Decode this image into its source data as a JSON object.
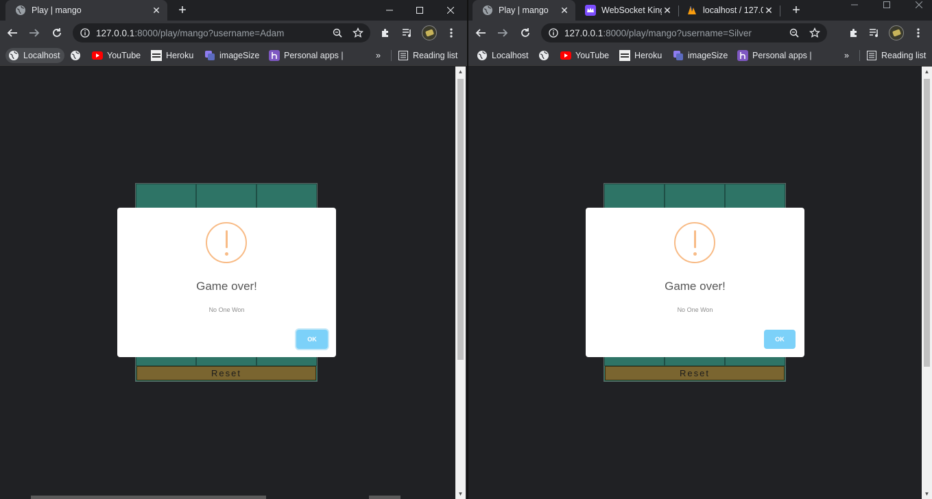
{
  "left": {
    "tabs": [
      {
        "title": "Play | mango",
        "active": true
      }
    ],
    "url": {
      "host": "127.0.0.1",
      "path": ":8000/play/mango?username=Adam"
    },
    "bookmarks": [
      "Localhost",
      "",
      "YouTube",
      "Heroku",
      "imageSize",
      "Personal apps |"
    ],
    "reading_list": "Reading list",
    "board": {
      "reset_label": "Reset"
    },
    "modal": {
      "title": "Game over!",
      "text": "No One Won",
      "ok_label": "OK"
    }
  },
  "right": {
    "tabs": [
      {
        "title": "Play | mango",
        "active": true
      },
      {
        "title": "WebSocket King",
        "active": false
      },
      {
        "title": "localhost / 127.0",
        "active": false
      }
    ],
    "url": {
      "host": "127.0.0.1",
      "path": ":8000/play/mango?username=Silver"
    },
    "bookmarks": [
      "Localhost",
      "",
      "YouTube",
      "Heroku",
      "imageSize",
      "Personal apps |"
    ],
    "reading_list": "Reading list",
    "board": {
      "reset_label": "Reset"
    },
    "modal": {
      "title": "Game over!",
      "text": "No One Won",
      "ok_label": "OK"
    }
  },
  "colors": {
    "chrome_dark": "#202124",
    "toolbar": "#35363a",
    "board_green": "#2e7466",
    "reset_gold": "#7a6530",
    "warning_orange": "#f8bb86",
    "ok_blue": "#7cd1f9"
  }
}
